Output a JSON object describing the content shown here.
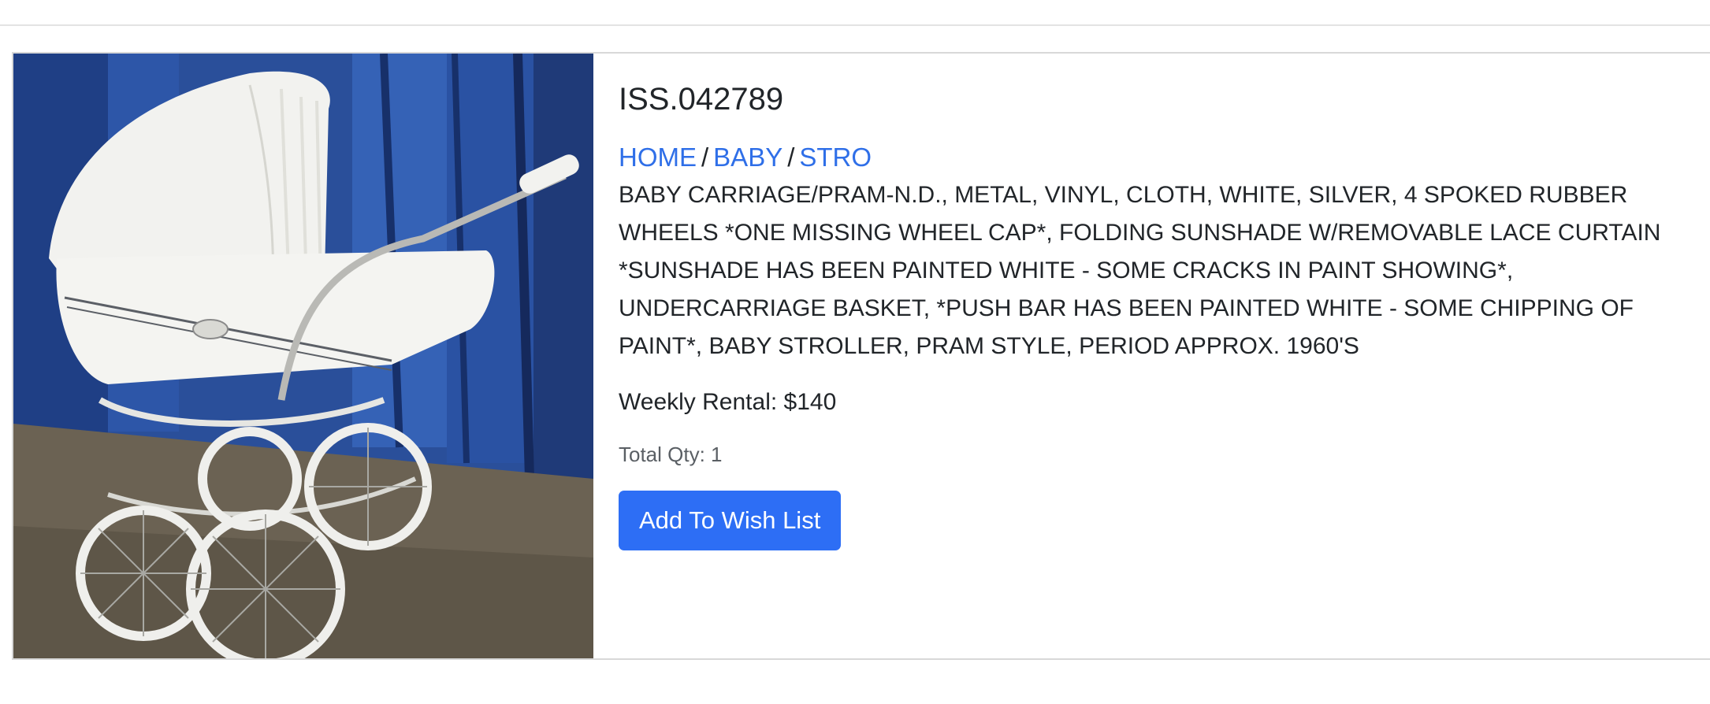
{
  "item": {
    "code": "ISS.042789",
    "photo_icon": "baby-carriage-photo",
    "breadcrumb": [
      {
        "label": "HOME"
      },
      {
        "label": "BABY"
      },
      {
        "label": "STRO"
      }
    ],
    "breadcrumb_separator": "/",
    "description": "BABY CARRIAGE/PRAM-N.D., METAL, VINYL, CLOTH, WHITE, SILVER, 4 SPOKED RUBBER WHEELS *ONE MISSING WHEEL CAP*, FOLDING SUNSHADE W/REMOVABLE LACE CURTAIN *SUNSHADE HAS BEEN PAINTED WHITE - SOME CRACKS IN PAINT SHOWING*, UNDERCARRIAGE BASKET, *PUSH BAR HAS BEEN PAINTED WHITE - SOME CHIPPING OF PAINT*, BABY STROLLER, PRAM STYLE, PERIOD APPROX. 1960'S",
    "weekly_rental": "Weekly Rental: $140",
    "total_qty": "Total Qty: 1",
    "wishlist_label": "Add To Wish List"
  },
  "colors": {
    "link": "#2f6fe8",
    "button": "#2d6ef5",
    "border": "#d8d8d8"
  }
}
